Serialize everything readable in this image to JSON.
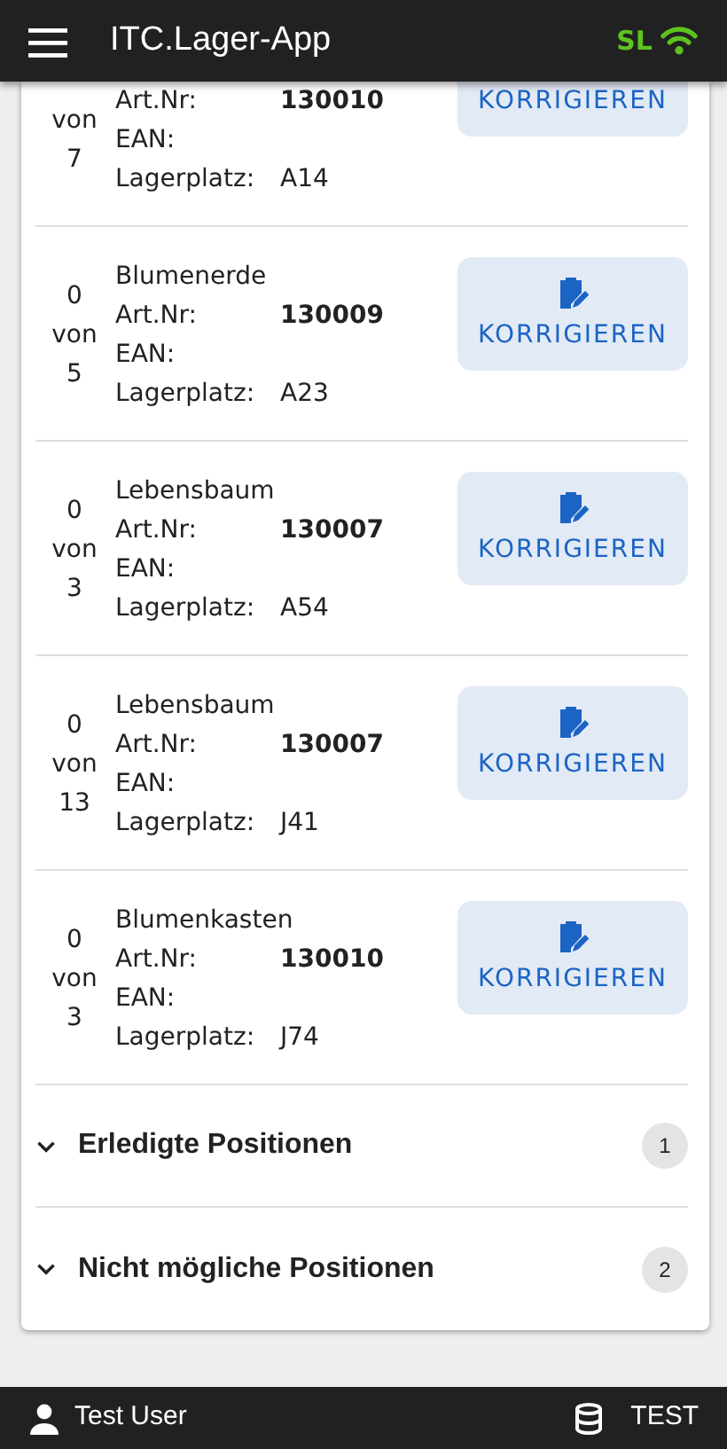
{
  "app_bar": {
    "title": "ITC.Lager-App",
    "status_label": "SL"
  },
  "positions": [
    {
      "kind": "partial",
      "count_of": "von",
      "count_total": "7",
      "art_label": "Art.Nr:",
      "art_nr": "130010",
      "ean_label": "EAN:",
      "place_label": "Lagerplatz:",
      "place": "A14",
      "button": "KORRIGIEREN"
    },
    {
      "kind": "full",
      "count_done": "0",
      "count_of": "von",
      "count_total": "5",
      "name": "Blumenerde",
      "art_label": "Art.Nr:",
      "art_nr": "130009",
      "ean_label": "EAN:",
      "place_label": "Lagerplatz:",
      "place": "A23",
      "button": "KORRIGIEREN"
    },
    {
      "kind": "full",
      "count_done": "0",
      "count_of": "von",
      "count_total": "3",
      "name": "Lebensbaum",
      "art_label": "Art.Nr:",
      "art_nr": "130007",
      "ean_label": "EAN:",
      "place_label": "Lagerplatz:",
      "place": "A54",
      "button": "KORRIGIEREN"
    },
    {
      "kind": "full",
      "count_done": "0",
      "count_of": "von",
      "count_total": "13",
      "name": "Lebensbaum",
      "art_label": "Art.Nr:",
      "art_nr": "130007",
      "ean_label": "EAN:",
      "place_label": "Lagerplatz:",
      "place": "J41",
      "button": "KORRIGIEREN"
    },
    {
      "kind": "full",
      "count_done": "0",
      "count_of": "von",
      "count_total": "3",
      "name": "Blumenkasten",
      "art_label": "Art.Nr:",
      "art_nr": "130010",
      "ean_label": "EAN:",
      "place_label": "Lagerplatz:",
      "place": "J74",
      "button": "KORRIGIEREN"
    }
  ],
  "sections": [
    {
      "title": "Erledigte Positionen",
      "count": "1",
      "expanded": false
    },
    {
      "title": "Nicht mögliche Positionen",
      "count": "2",
      "expanded": false
    }
  ],
  "footer": {
    "user": "Test User",
    "database": "TEST"
  }
}
